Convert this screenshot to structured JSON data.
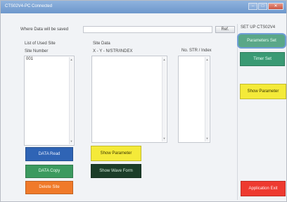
{
  "window": {
    "title": "CTS02V4-PC Connected"
  },
  "save_path": {
    "label": "Where Data will be saved",
    "value": "",
    "ref_button": "Ref."
  },
  "used_sites": {
    "heading": "List of Used Site",
    "column": "Site Number",
    "items": [
      "001"
    ]
  },
  "site_data": {
    "heading": "Site Data",
    "columns": "X -  Y -  N/STR/INDEX"
  },
  "str_index": {
    "column": "No.  STR / Index"
  },
  "left_buttons": {
    "data_read": "DATA Read",
    "data_copy": "DATA Copy",
    "delete_site": "Delete Site"
  },
  "middle_buttons": {
    "show_parameter": "Show Parameter",
    "show_wave_form": "Show Wave Form"
  },
  "side_panel": {
    "heading": "SET UP CTS02V4",
    "parameters_set": "Parameters Set",
    "timer_set": "Timer Set",
    "show_parameter": "Show Parameter",
    "application_exit": "Application Exit"
  },
  "colors": {
    "blue": "#2f64b5",
    "green": "#3c9a5f",
    "orange": "#f07a2a",
    "yellow": "#f4ea39",
    "dark_green": "#1c3d29",
    "teal": "#3a9a74",
    "red": "#ee3a30"
  }
}
